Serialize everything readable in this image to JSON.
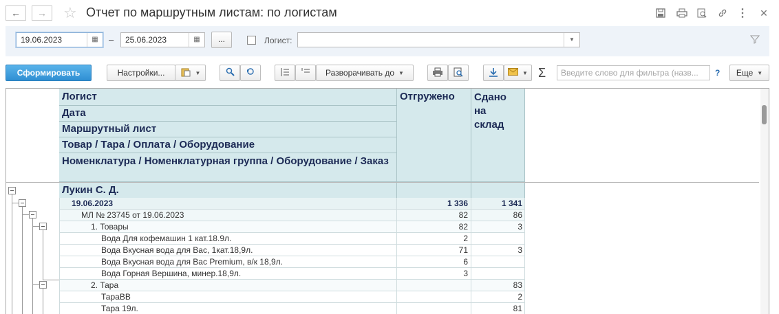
{
  "nav": {
    "back_icon": "arrow-left-icon",
    "forward_icon": "arrow-right-icon",
    "favorite_icon": "star-icon"
  },
  "window": {
    "title": "Отчет по маршрутным листам: по логистам"
  },
  "filters": {
    "date_from": "19.06.2023",
    "date_separator": "–",
    "date_to": "25.06.2023",
    "period_button": "...",
    "logist_label": "Логист:",
    "logist_value": ""
  },
  "toolbar": {
    "generate": "Сформировать",
    "settings": "Настройки...",
    "expand_to": "Разворачивать до",
    "sum_symbol": "Σ",
    "search_placeholder": "Введите слово для фильтра (назв...",
    "help": "?",
    "more": "Еще"
  },
  "report": {
    "group_headers": [
      "Логист",
      "Дата",
      "Маршрутный лист",
      "Товар / Тара / Оплата / Оборудование",
      "Номенклатура / Номенклатурная группа / Оборудование / Заказ"
    ],
    "col_shipped": "Отгружено",
    "col_delivered_line1": "Сдано",
    "col_delivered_line2": "на",
    "col_delivered_line3": "склад",
    "logist_name": "Лукин С. Д.",
    "rows": [
      {
        "label": "19.06.2023",
        "shipped": "1 336",
        "delivered": "1 341"
      },
      {
        "label": "МЛ № 23745 от 19.06.2023",
        "shipped": "82",
        "delivered": "86"
      },
      {
        "label": "1. Товары",
        "shipped": "82",
        "delivered": "3"
      },
      {
        "label": "Вода Для кофемашин 1 кат.18.9л.",
        "shipped": "2",
        "delivered": ""
      },
      {
        "label": "Вода Вкусная вода для Вас, 1кат.18,9л.",
        "shipped": "71",
        "delivered": "3"
      },
      {
        "label": "Вода Вкусная вода для Вас Premium, в/к 18,9л.",
        "shipped": "6",
        "delivered": ""
      },
      {
        "label": "Вода Горная Вершина, минер.18,9л.",
        "shipped": "3",
        "delivered": ""
      },
      {
        "label": "2. Тара",
        "shipped": "",
        "delivered": "83"
      },
      {
        "label": "ТараВВ",
        "shipped": "",
        "delivered": "2"
      },
      {
        "label": "Тара 19л.",
        "shipped": "",
        "delivered": "81"
      }
    ]
  }
}
